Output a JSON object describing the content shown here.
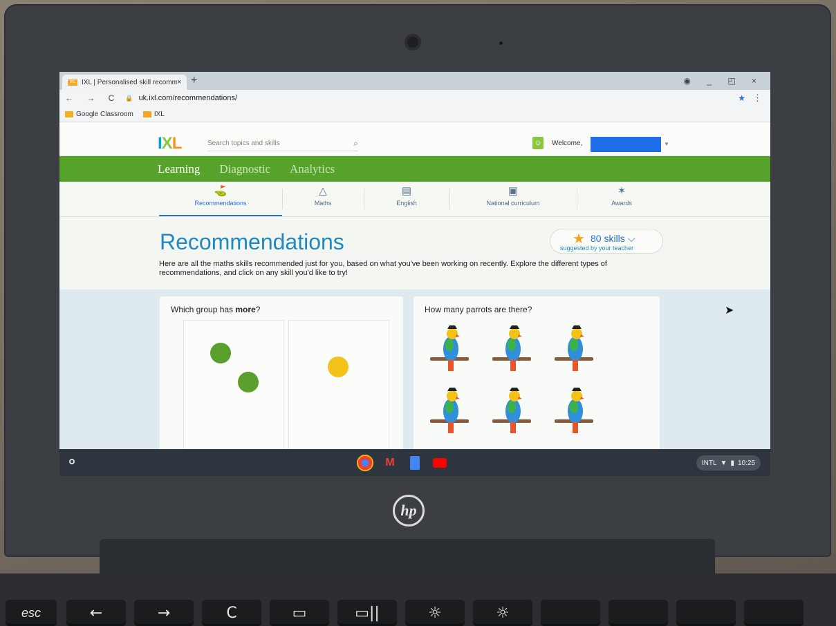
{
  "browser": {
    "tab_title": "IXL | Personalised skill recomme",
    "tab_favicon": "IXL",
    "tab_close": "×",
    "new_tab": "+",
    "window_controls": "◉ _ ◰ ×",
    "nav_buttons": "← → C",
    "url": "uk.ixl.com/recommendations/",
    "bookmarks": [
      {
        "label": "Google Classroom",
        "icon": "classroom-icon"
      },
      {
        "label": "IXL",
        "icon": "ixl-icon"
      }
    ]
  },
  "header": {
    "logo": {
      "i": "I",
      "x": "X",
      "l": "L"
    },
    "search_placeholder": "Search topics and skills",
    "welcome": "Welcome,"
  },
  "main_nav": {
    "items": [
      {
        "label": "Learning",
        "active": true
      },
      {
        "label": "Diagnostic",
        "active": false
      },
      {
        "label": "Analytics",
        "active": false
      }
    ]
  },
  "sub_nav": {
    "items": [
      {
        "label": "Recommendations",
        "icon": "signpost-icon",
        "active": true
      },
      {
        "label": "Maths",
        "icon": "pyramid-icon"
      },
      {
        "label": "English",
        "icon": "book-icon"
      },
      {
        "label": "National curriculum",
        "icon": "clipboard-icon"
      },
      {
        "label": "Awards",
        "icon": "confetti-icon"
      }
    ]
  },
  "page": {
    "title": "Recommendations",
    "skills_count": "80 skills",
    "skills_caption": "suggested by your teacher",
    "description": "Here are all the maths skills recommended just for you, based on what you've been working on recently. Explore the different types of recommendations, and click on any skill you'd like to try!"
  },
  "cards": [
    {
      "question_prefix": "Which group has ",
      "question_bold": "more",
      "question_suffix": "?"
    },
    {
      "question": "How many parrots are there?"
    }
  ],
  "colors": {
    "ixl_green": "#56a22a",
    "accent_blue": "#1f8ac0",
    "dot_green": "#5a9e2e",
    "dot_yellow": "#f3c21a"
  },
  "shelf": {
    "apps": [
      "chrome-icon",
      "gmail-icon",
      "docs-icon",
      "youtube-icon"
    ],
    "tray_locale": "INTL",
    "tray_time": "10:25"
  },
  "device": {
    "brand": "hp",
    "keys": [
      "esc",
      "←",
      "→",
      "C",
      "▭",
      "▭||",
      "☼",
      "☼"
    ]
  }
}
